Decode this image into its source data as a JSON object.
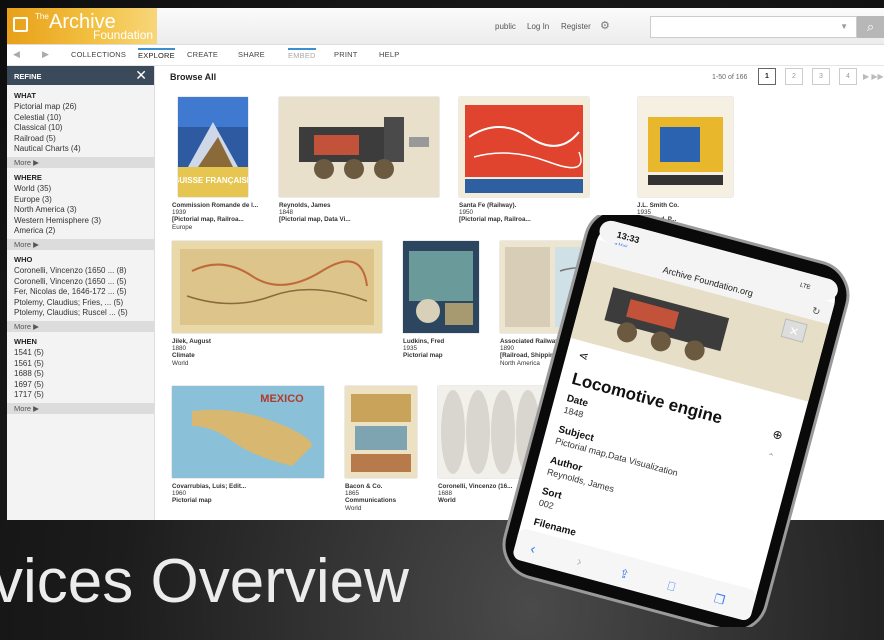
{
  "logo": {
    "the": "The",
    "archive": "Archive",
    "foundation": "Foundation"
  },
  "header": {
    "links": [
      "public",
      "Log In",
      "Register"
    ],
    "gear_icon": "gear-icon",
    "search_placeholder": "",
    "search_icon": "search-icon"
  },
  "nav": {
    "tabs": [
      "COLLECTIONS",
      "EXPLORE",
      "CREATE",
      "SHARE",
      "EMBED",
      "PRINT",
      "HELP"
    ],
    "active": "EXPLORE"
  },
  "sidebar": {
    "title": "REFINE",
    "groups": [
      {
        "heading": "WHAT",
        "items": [
          "Pictorial map (26)",
          "Celestial (10)",
          "Classical (10)",
          "Railroad (5)",
          "Nautical Charts (4)"
        ],
        "more": "More ▶"
      },
      {
        "heading": "WHERE",
        "items": [
          "World (35)",
          "Europe (3)",
          "North America (3)",
          "Western Hemisphere (3)",
          "America (2)"
        ],
        "more": "More ▶"
      },
      {
        "heading": "WHO",
        "items": [
          "Coronelli, Vincenzo (1650 ... (8)",
          "Coronelli, Vincenzo (1650 ... (5)",
          "Fer, Nicolas de, 1646-172 ... (5)",
          "Ptolemy, Claudius; Fries, ... (5)",
          "Ptolemy, Claudius; Ruscel ... (5)"
        ],
        "more": "More ▶"
      },
      {
        "heading": "WHEN",
        "items": [
          "1541 (5)",
          "1561 (5)",
          "1688 (5)",
          "1697 (5)",
          "1717 (5)"
        ],
        "more": "More ▶"
      }
    ]
  },
  "main": {
    "title": "Browse All",
    "count": "1-50 of 166",
    "pages": [
      "1",
      "2",
      "3",
      "4"
    ],
    "items": [
      {
        "name": "Commission Romande de l...",
        "year": "1939",
        "subject": "[Pictorial map, Railroa...",
        "place": "Europe",
        "art": "SUISSE FRANÇAISE"
      },
      {
        "name": "Reynolds, James",
        "year": "1848",
        "subject": "[Pictorial map, Data Vi...",
        "place": ""
      },
      {
        "name": "Santa Fe (Railway).",
        "year": "1950",
        "subject": "[Pictorial map, Railroa...",
        "place": ""
      },
      {
        "name": "J.L. Smith Co.",
        "year": "1935",
        "subject": "[Railroad, P...",
        "place": ""
      },
      {
        "name": "Jilek, August",
        "year": "1880",
        "subject": "Climate",
        "place": "World"
      },
      {
        "name": "Ludkins, Fred",
        "year": "1935",
        "subject": "Pictorial map",
        "place": ""
      },
      {
        "name": "Associated Railway Land...",
        "year": "1890",
        "subject": "[Railroad, Shipping]",
        "place": "North America"
      },
      {
        "name": "Covarrubias, Luis; Edit...",
        "year": "1960",
        "subject": "Pictorial map",
        "place": "",
        "art": "MEXICO"
      },
      {
        "name": "Bacon & Co.",
        "year": "1865",
        "subject": "Communications",
        "place": "World"
      },
      {
        "name": "Coronelli, Vincenzo (16...",
        "year": "1688",
        "subject": "World",
        "place": ""
      }
    ]
  },
  "phone": {
    "time": "13:33",
    "carrier": "◂ Mail",
    "status": "LTE",
    "url": "Archive Foundation.org",
    "title": "Locomotive engine",
    "fields": [
      {
        "label": "Date",
        "value": "1848"
      },
      {
        "label": "Subject",
        "value": "Pictorial map,Data Visualization"
      },
      {
        "label": "Author",
        "value": "Reynolds, James"
      },
      {
        "label": "Sort",
        "value": "002"
      },
      {
        "label": "Filename",
        "value": ""
      }
    ]
  },
  "banner": "vices Overview"
}
